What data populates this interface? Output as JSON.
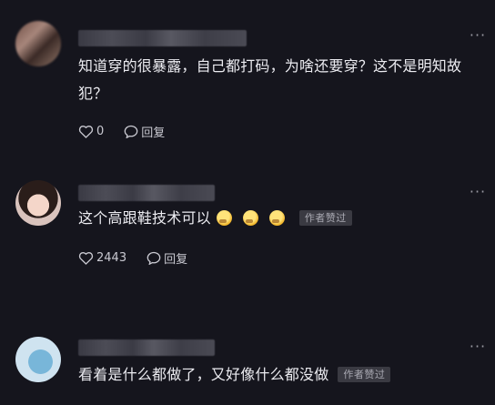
{
  "comments": [
    {
      "text": "知道穿的很暴露，自己都打码，为啥还要穿？这不是明知故犯？",
      "likes": "0",
      "reply_label": "回复",
      "badge": null
    },
    {
      "text": "这个高跟鞋技术可以",
      "likes": "2443",
      "reply_label": "回复",
      "badge": "作者赞过"
    },
    {
      "text": "看着是什么都做了，又好像什么都没做",
      "badge": "作者赞过"
    }
  ],
  "icons": {
    "like": "heart-outline-icon",
    "reply": "speech-bubble-icon",
    "more": "more-dots-icon",
    "emoji": "grimace-face-emoji"
  }
}
